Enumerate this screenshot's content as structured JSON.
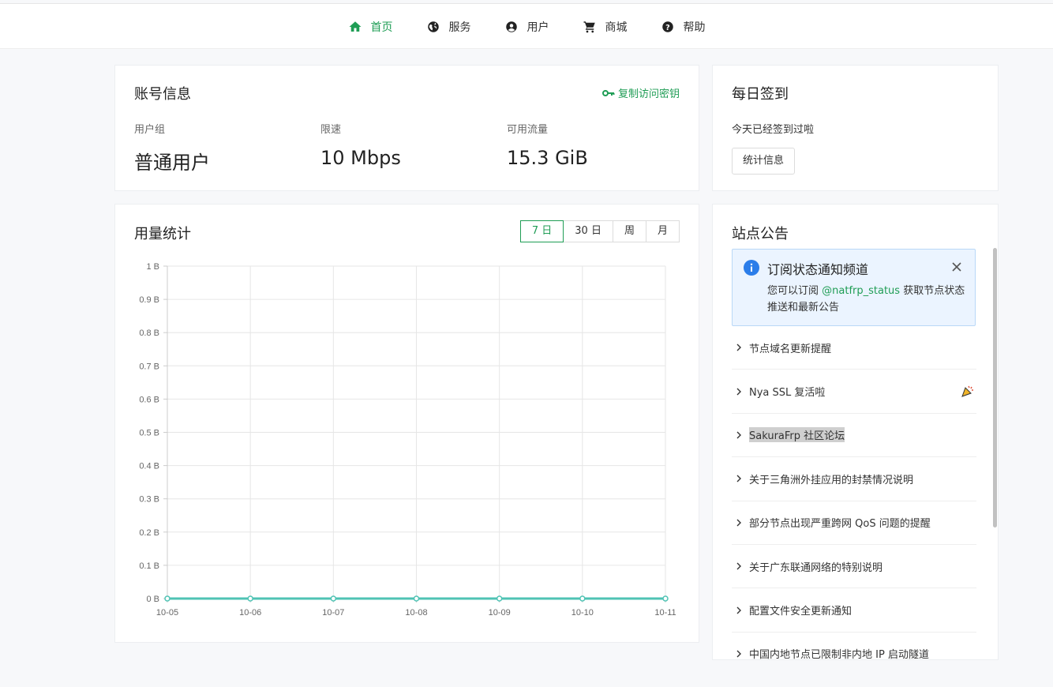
{
  "nav": {
    "items": [
      {
        "label": "首页",
        "icon": "home-icon",
        "active": true
      },
      {
        "label": "服务",
        "icon": "globe-icon",
        "active": false
      },
      {
        "label": "用户",
        "icon": "user-circle-icon",
        "active": false
      },
      {
        "label": "商城",
        "icon": "cart-icon",
        "active": false
      },
      {
        "label": "帮助",
        "icon": "help-circle-icon",
        "active": false
      }
    ]
  },
  "account": {
    "title": "账号信息",
    "copy_key_label": "复制访问密钥",
    "stats": [
      {
        "label": "用户组",
        "value": "普通用户"
      },
      {
        "label": "限速",
        "value": "10 Mbps"
      },
      {
        "label": "可用流量",
        "value": "15.3 GiB"
      }
    ]
  },
  "checkin": {
    "title": "每日签到",
    "message": "今天已经签到过啦",
    "button_label": "统计信息"
  },
  "usage": {
    "title": "用量统计",
    "ranges": [
      "7 日",
      "30 日",
      "周",
      "月"
    ],
    "active_range": "7 日"
  },
  "chart_data": {
    "type": "line",
    "x": [
      "10-05",
      "10-06",
      "10-07",
      "10-08",
      "10-09",
      "10-10",
      "10-11"
    ],
    "series": [
      {
        "values": [
          0,
          0,
          0,
          0,
          0,
          0,
          0
        ]
      }
    ],
    "y_ticks": [
      "0 B",
      "0.1 B",
      "0.2 B",
      "0.3 B",
      "0.4 B",
      "0.5 B",
      "0.6 B",
      "0.7 B",
      "0.8 B",
      "0.9 B",
      "1 B"
    ],
    "ylim": [
      0,
      1
    ],
    "grid": true,
    "line_color": "#4fc3b4"
  },
  "notice": {
    "title": "站点公告",
    "alert": {
      "title": "订阅状态通知频道",
      "body_prefix": "您可以订阅 ",
      "body_link": "@natfrp_status",
      "body_suffix": " 获取节点状态推送和最新公告"
    },
    "items": [
      {
        "label": "节点域名更新提醒"
      },
      {
        "label": "Nya SSL 复活啦",
        "badge": "party-icon"
      },
      {
        "label": "SakuraFrp 社区论坛",
        "highlight": true
      },
      {
        "label": "关于三角洲外挂应用的封禁情况说明"
      },
      {
        "label": "部分节点出现严重跨网 QoS 问题的提醒"
      },
      {
        "label": "关于广东联通网络的特别说明"
      },
      {
        "label": "配置文件安全更新通知"
      },
      {
        "label": "中国内地节点已限制非内地 IP 启动隧道"
      }
    ]
  },
  "colors": {
    "accent": "#1f9d55",
    "info": "#2b7de9"
  }
}
